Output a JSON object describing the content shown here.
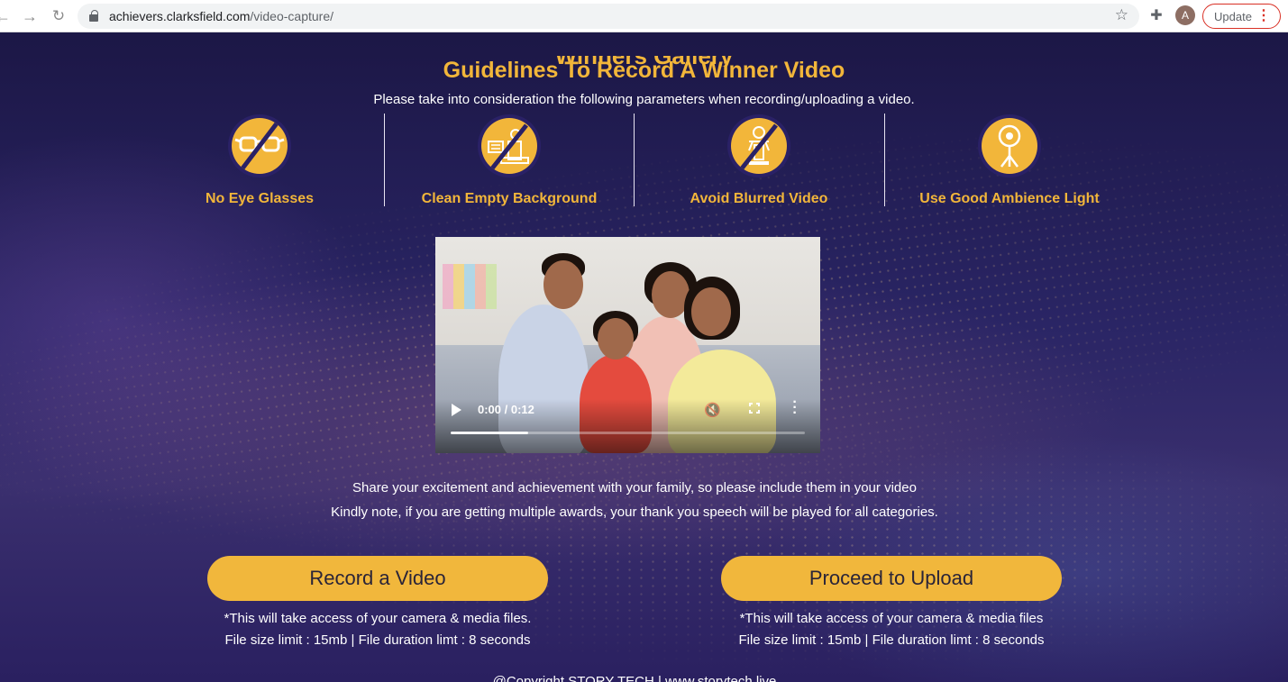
{
  "browser": {
    "url_domain": "achievers.clarksfield.com",
    "url_path": "/video-capture/",
    "profile_initial": "A",
    "update_label": "Update"
  },
  "page": {
    "cut_heading": "Winners Gallery",
    "title": "Guidelines To Record A Winner Video",
    "subtitle": "Please take into consideration the following parameters when recording/uploading a video.",
    "guidelines": [
      {
        "label": "No Eye Glasses",
        "icon": "no-glasses-icon"
      },
      {
        "label": "Clean Empty Background",
        "icon": "no-clutter-icon"
      },
      {
        "label": "Avoid Blurred Video",
        "icon": "no-blur-icon"
      },
      {
        "label": "Use Good Ambience Light",
        "icon": "light-icon"
      }
    ],
    "video": {
      "time": "0:00 / 0:12",
      "buffered": 0.22
    },
    "note_line1": "Share your excitement and achievement with your family, so please include them in your video",
    "note_line2": "Kindly note, if you are getting multiple awards, your thank you speech will be played for all categories.",
    "record": {
      "label": "Record a Video",
      "fine1": "*This will take access of your camera & media files.",
      "fine2": "File size limit : 15mb | File duration limt : 8 seconds"
    },
    "upload": {
      "label": "Proceed to Upload",
      "fine1": "*This will take access of your camera & media files",
      "fine2": "File size limit : 15mb | File duration limt : 8 seconds"
    },
    "copyright": "@Copyright STORY TECH | www.storytech.live"
  },
  "colors": {
    "accent": "#f2b63a",
    "background": "#1d1a4a"
  }
}
